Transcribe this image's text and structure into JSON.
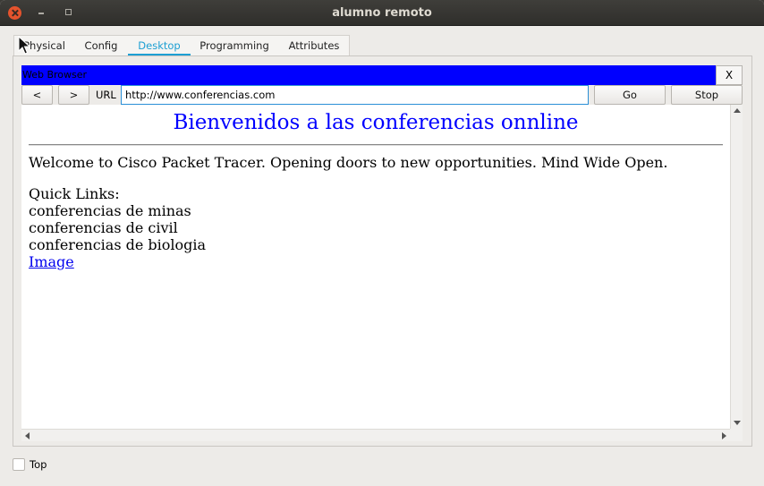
{
  "window": {
    "title": "alumno remoto"
  },
  "tabs": [
    {
      "label": "Physical",
      "active": false
    },
    {
      "label": "Config",
      "active": false
    },
    {
      "label": "Desktop",
      "active": true
    },
    {
      "label": "Programming",
      "active": false
    },
    {
      "label": "Attributes",
      "active": false
    }
  ],
  "browser": {
    "title": "Web Browser",
    "close_label": "X",
    "back_label": "<",
    "forward_label": ">",
    "url_label": "URL",
    "url_value": "http://www.conferencias.com",
    "go_label": "Go",
    "stop_label": "Stop"
  },
  "page": {
    "heading": "Bienvenidos a las conferencias onnline",
    "welcome": "Welcome to Cisco Packet Tracer. Opening doors to new opportunities. Mind Wide Open.",
    "quick_links_title": "Quick Links:",
    "links": [
      "conferencias de minas",
      "conferencias de civil",
      "conferencias de biologia"
    ],
    "image_link": "Image"
  },
  "footer": {
    "top_label": "Top",
    "top_checked": false
  },
  "colors": {
    "accent": "#1d9fd3",
    "browser_bar": "#0000ff",
    "heading": "#0000ff",
    "link": "#0000ee"
  }
}
